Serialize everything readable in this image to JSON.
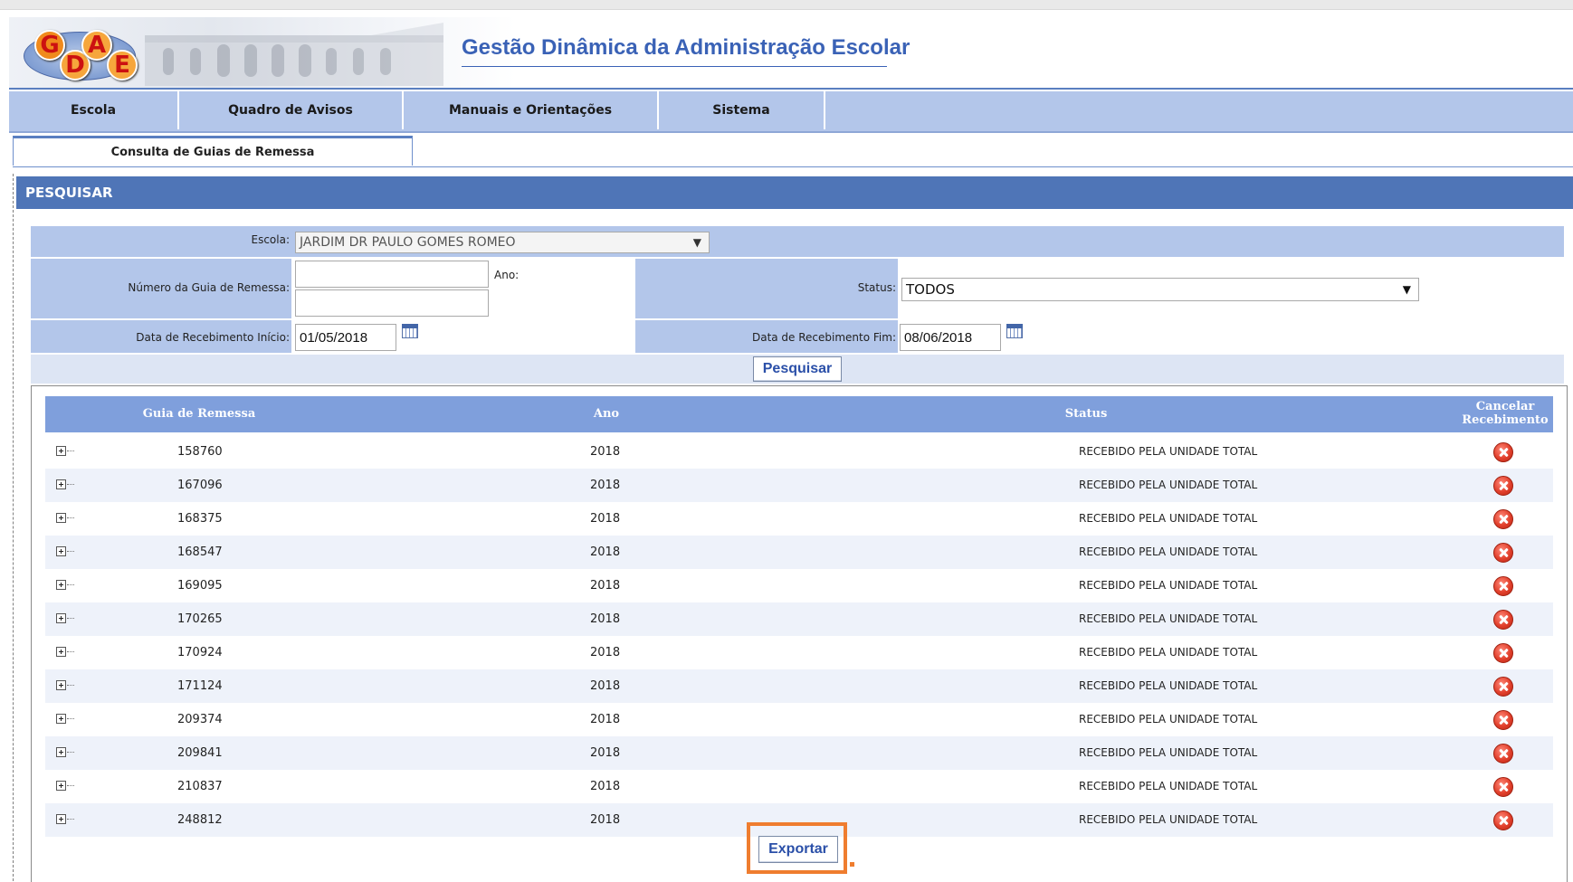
{
  "header": {
    "logo_letters": [
      "G",
      "D",
      "A",
      "E"
    ],
    "title": "Gestão Dinâmica da Administração Escolar"
  },
  "nav": {
    "items": [
      {
        "label": "Escola"
      },
      {
        "label": "Quadro de Avisos"
      },
      {
        "label": "Manuais e Orientações"
      },
      {
        "label": "Sistema"
      }
    ]
  },
  "tab": {
    "label": "Consulta de Guias de Remessa"
  },
  "search": {
    "section_title": "PESQUISAR",
    "escola_label": "Escola:",
    "escola_value": "JARDIM DR PAULO GOMES ROMEO",
    "numero_label": "Número da Guia de Remessa:",
    "numero_value": "",
    "ano_label": "Ano:",
    "ano_value": "",
    "status_label": "Status:",
    "status_value": "TODOS",
    "data_inicio_label": "Data de Recebimento Início:",
    "data_inicio_value": "01/05/2018",
    "data_fim_label": "Data de Recebimento Fim:",
    "data_fim_value": "08/06/2018",
    "search_button": "Pesquisar"
  },
  "table": {
    "headers": {
      "guia": "Guia de Remessa",
      "ano": "Ano",
      "status": "Status",
      "cancelar_line1": "Cancelar",
      "cancelar_line2": "Recebimento"
    },
    "rows": [
      {
        "guia": "158760",
        "ano": "2018",
        "status": "RECEBIDO PELA UNIDADE TOTAL"
      },
      {
        "guia": "167096",
        "ano": "2018",
        "status": "RECEBIDO PELA UNIDADE TOTAL"
      },
      {
        "guia": "168375",
        "ano": "2018",
        "status": "RECEBIDO PELA UNIDADE TOTAL"
      },
      {
        "guia": "168547",
        "ano": "2018",
        "status": "RECEBIDO PELA UNIDADE TOTAL"
      },
      {
        "guia": "169095",
        "ano": "2018",
        "status": "RECEBIDO PELA UNIDADE TOTAL"
      },
      {
        "guia": "170265",
        "ano": "2018",
        "status": "RECEBIDO PELA UNIDADE TOTAL"
      },
      {
        "guia": "170924",
        "ano": "2018",
        "status": "RECEBIDO PELA UNIDADE TOTAL"
      },
      {
        "guia": "171124",
        "ano": "2018",
        "status": "RECEBIDO PELA UNIDADE TOTAL"
      },
      {
        "guia": "209374",
        "ano": "2018",
        "status": "RECEBIDO PELA UNIDADE TOTAL"
      },
      {
        "guia": "209841",
        "ano": "2018",
        "status": "RECEBIDO PELA UNIDADE TOTAL"
      },
      {
        "guia": "210837",
        "ano": "2018",
        "status": "RECEBIDO PELA UNIDADE TOTAL"
      },
      {
        "guia": "248812",
        "ano": "2018",
        "status": "RECEBIDO PELA UNIDADE TOTAL"
      }
    ],
    "row_icons": {
      "expand": "expand-plus-icon",
      "cancel": "cancel-x-icon"
    }
  },
  "export_button": "Exportar",
  "colors": {
    "brand_blue": "#3a62b6",
    "nav_bg": "#b3c6ea",
    "section_bar": "#4f75b7",
    "table_header": "#7f9fdc",
    "highlight": "#ef7d2f",
    "cancel_red": "#e2402c"
  }
}
